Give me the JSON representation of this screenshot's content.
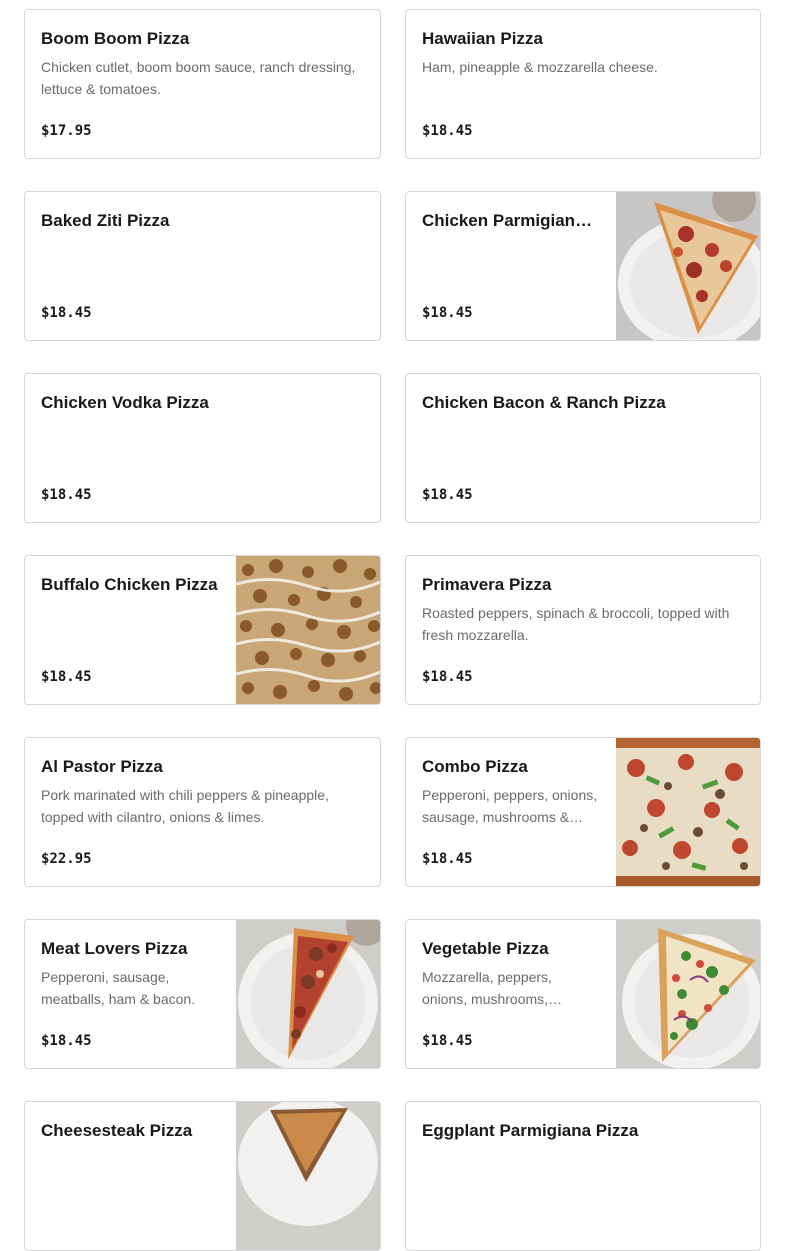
{
  "menu": {
    "items": [
      {
        "name": "Boom Boom Pizza",
        "description": "Chicken cutlet, boom boom sauce, ranch dressing, lettuce & tomatoes.",
        "price": "$17.95",
        "photo": "none"
      },
      {
        "name": "Hawaiian Pizza",
        "description": "Ham, pineapple & mozzarella cheese.",
        "price": "$18.45",
        "photo": "none"
      },
      {
        "name": "Baked Ziti Pizza",
        "description": "",
        "price": "$18.45",
        "photo": "none"
      },
      {
        "name": "Chicken Parmigiana Pizza",
        "description": "",
        "price": "$18.45",
        "photo": "pizza-slice-on-plate"
      },
      {
        "name": "Chicken Vodka Pizza",
        "description": "",
        "price": "$18.45",
        "photo": "none"
      },
      {
        "name": "Chicken Bacon & Ranch Pizza",
        "description": "",
        "price": "$18.45",
        "photo": "none"
      },
      {
        "name": "Buffalo Chicken Pizza",
        "description": "",
        "price": "$18.45",
        "photo": "buffalo-chicken-pizza-closeup"
      },
      {
        "name": "Primavera Pizza",
        "description": "Roasted peppers, spinach & broccoli, topped with fresh mozzarella.",
        "price": "$18.45",
        "photo": "none"
      },
      {
        "name": "Al Pastor Pizza",
        "description": "Pork marinated with chili peppers & pineapple, topped with cilantro, onions & limes.",
        "price": "$22.95",
        "photo": "none"
      },
      {
        "name": "Combo Pizza",
        "description": "Pepperoni, peppers, onions, sausage, mushrooms & meatballs.",
        "price": "$18.45",
        "photo": "combo-pizza-closeup"
      },
      {
        "name": "Meat Lovers Pizza",
        "description": "Pepperoni, sausage, meatballs, ham & bacon.",
        "price": "$18.45",
        "photo": "pizza-slice-on-plate"
      },
      {
        "name": "Vegetable Pizza",
        "description": "Mozzarella, peppers, onions, mushrooms, broccoli & tomatoes.",
        "price": "$18.45",
        "photo": "pizza-slice-on-plate"
      },
      {
        "name": "Cheesesteak Pizza",
        "description": "",
        "price": "",
        "photo": "pizza-slice-on-plate"
      },
      {
        "name": "Eggplant Parmigiana Pizza",
        "description": "",
        "price": "",
        "photo": "none"
      }
    ]
  },
  "colors": {
    "card_border": "#d6d6d6",
    "title_text": "#191919",
    "description_text": "#6b6b6b",
    "price_text": "#191919"
  }
}
